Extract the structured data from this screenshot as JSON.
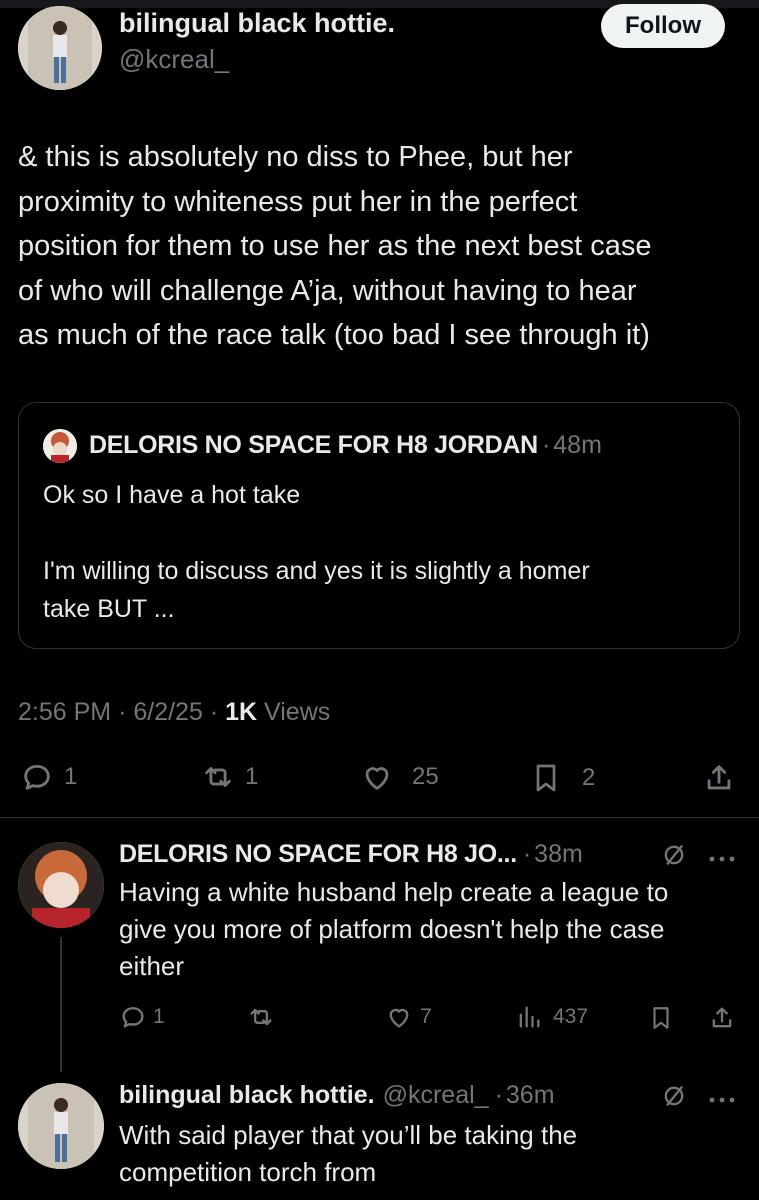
{
  "main_tweet": {
    "author_name": "bilingual black hottie.",
    "author_handle": "@kcreal_",
    "follow_label": "Follow",
    "text_lines": [
      "& this is absolutely no diss to Phee, but her",
      "proximity to whiteness put her in the perfect",
      "position for them to use her as the next best case",
      "of who will challenge A’ja, without having to hear",
      "as much of the race talk (too bad I see through it)"
    ],
    "quote": {
      "author_name": "DELORIS NO SPACE FOR H8 JORDAN",
      "separator": "·",
      "time": "48m",
      "line1": "Ok so I have a hot take",
      "line2": "I'm willing to discuss and yes it is slightly a homer",
      "line3": "take BUT ..."
    },
    "meta": {
      "time": "2:56 PM",
      "sep1": "·",
      "date": "6/2/25",
      "sep2": "·",
      "views_count": "1K",
      "views_label": "Views"
    },
    "actions": {
      "replies": "1",
      "retweets": "1",
      "likes": "25",
      "bookmarks": "2"
    }
  },
  "reply_1": {
    "author_name": "DELORIS NO SPACE FOR H8 JO...",
    "separator": "·",
    "time": "38m",
    "text_lines": [
      "Having a white husband help create a league to",
      "give you more of platform doesn't help the case",
      "either"
    ],
    "actions": {
      "replies": "1",
      "likes": "7",
      "views": "437"
    }
  },
  "reply_2": {
    "author_name": "bilingual black hottie.",
    "author_handle": "@kcreal_",
    "separator": "·",
    "time": "36m",
    "text_lines": [
      "With said player that you’ll be taking the",
      "competition torch from"
    ]
  },
  "icons": [
    "reply-icon",
    "retweet-icon",
    "like-icon",
    "bookmark-icon",
    "share-icon",
    "views-icon",
    "grok-icon",
    "more-icon"
  ]
}
